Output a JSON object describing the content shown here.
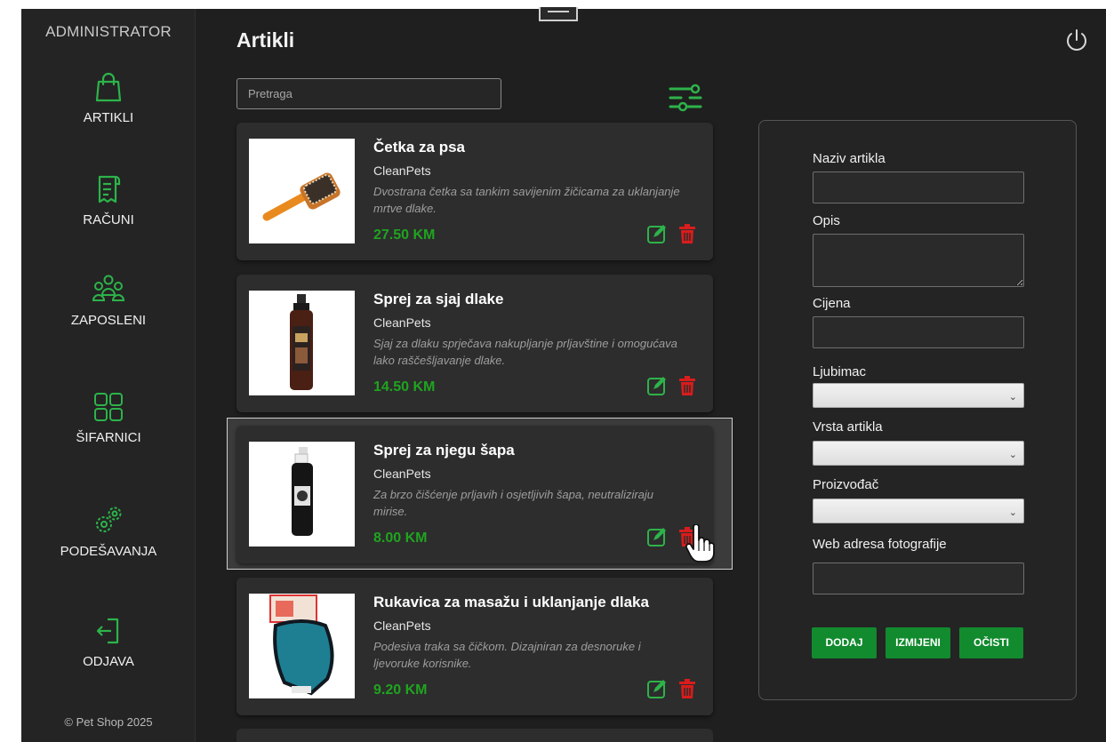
{
  "sidebar": {
    "title": "ADMINISTRATOR",
    "items": [
      {
        "label": "ARTIKLI",
        "icon": "shopping-bag-icon"
      },
      {
        "label": "RAČUNI",
        "icon": "receipt-icon"
      },
      {
        "label": "ZAPOSLENI",
        "icon": "users-icon"
      },
      {
        "label": "ŠIFARNICI",
        "icon": "grid-icon"
      },
      {
        "label": "PODEŠAVANJA",
        "icon": "gears-icon"
      },
      {
        "label": "ODJAVA",
        "icon": "logout-icon"
      }
    ],
    "footer": "© Pet Shop 2025"
  },
  "header": {
    "title": "Artikli",
    "power_icon": "power-icon"
  },
  "search": {
    "placeholder": "Pretraga"
  },
  "products": [
    {
      "name": "Četka za psa",
      "brand": "CleanPets",
      "description": "Dvostrana četka sa tankim savijenim žičicama za uklanjanje mrtve dlake.",
      "price": "27.50 KM"
    },
    {
      "name": "Sprej za sjaj dlake",
      "brand": "CleanPets",
      "description": "Sjaj za dlaku sprječava nakupljanje prljavštine i omogućava lako raščešljavanje dlake.",
      "price": "14.50 KM"
    },
    {
      "name": "Sprej za njegu šapa",
      "brand": "CleanPets",
      "description": "Za brzo čišćenje prljavih i osjetljivih šapa, neutraliziraju mirise.",
      "price": "8.00 KM"
    },
    {
      "name": "Rukavica za masažu i uklanjanje dlaka",
      "brand": "CleanPets",
      "description": "Podesiva traka sa čičkom. Dizajniran za desnoruke i ljevoruke korisnike.",
      "price": "9.20 KM"
    }
  ],
  "form": {
    "name_label": "Naziv artikla",
    "desc_label": "Opis",
    "price_label": "Cijena",
    "pet_label": "Ljubimac",
    "type_label": "Vrsta artikla",
    "maker_label": "Proizvođač",
    "photo_label": "Web adresa fotografije",
    "add_button": "DODAJ",
    "edit_button": "IZMIJENI",
    "clear_button": "OČISTI"
  },
  "colors": {
    "accent": "#1fa41f",
    "button": "#128a2e",
    "delete": "#d91c1c",
    "sidebar_bg": "#242424",
    "main_bg": "#1f1f1f",
    "card_bg": "#2d2d2d"
  }
}
